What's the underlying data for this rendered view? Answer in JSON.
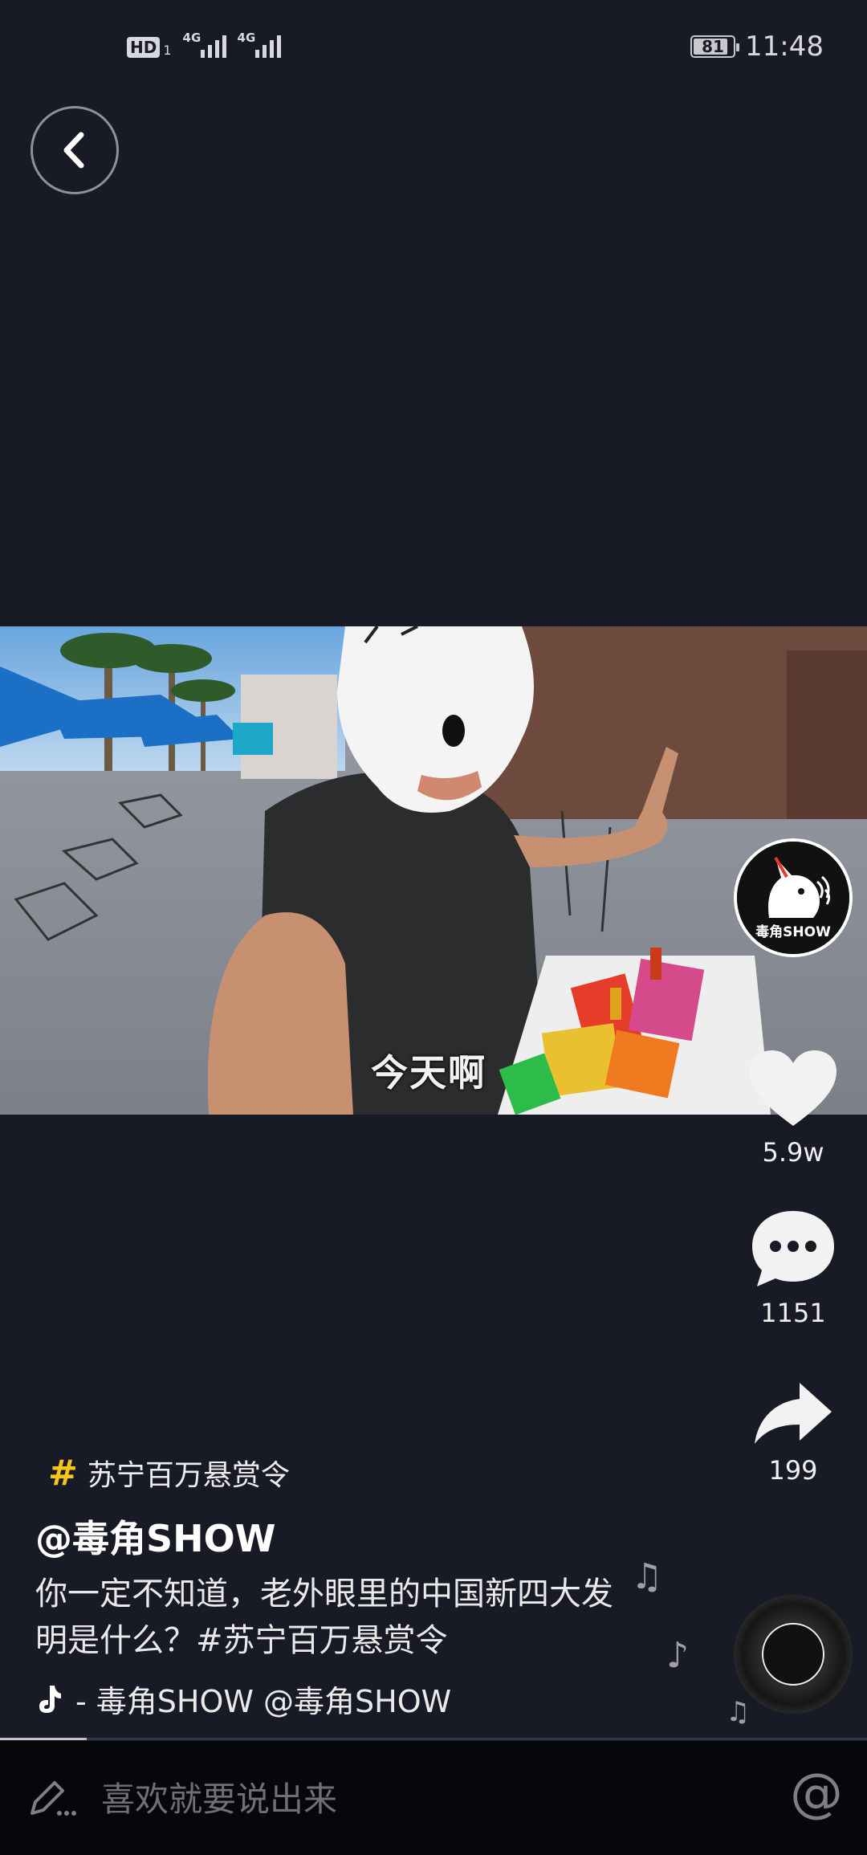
{
  "status_bar": {
    "hd": "HD",
    "hd_sub": "1",
    "net1": "4G",
    "net2": "4G",
    "battery": "81",
    "battery_level": 0.81,
    "time": "11:48"
  },
  "video": {
    "subtitle": "今天啊",
    "progress": 0.1
  },
  "avatar": {
    "logo_text": "毒角SHOW"
  },
  "actions": {
    "like_count": "5.9w",
    "comment_count": "1151",
    "share_count": "199"
  },
  "caption": {
    "topic": "苏宁百万悬赏令",
    "author": "@毒角SHOW",
    "description": "你一定不知道，老外眼里的中国新四大发明是什么？#苏宁百万悬赏令",
    "music": "- 毒角SHOW   @毒角SHOW"
  },
  "comment_bar": {
    "placeholder": "喜欢就要说出来",
    "at_symbol": "@"
  },
  "colors": {
    "background": "#181a26",
    "topic_hash": "#f5c518"
  }
}
